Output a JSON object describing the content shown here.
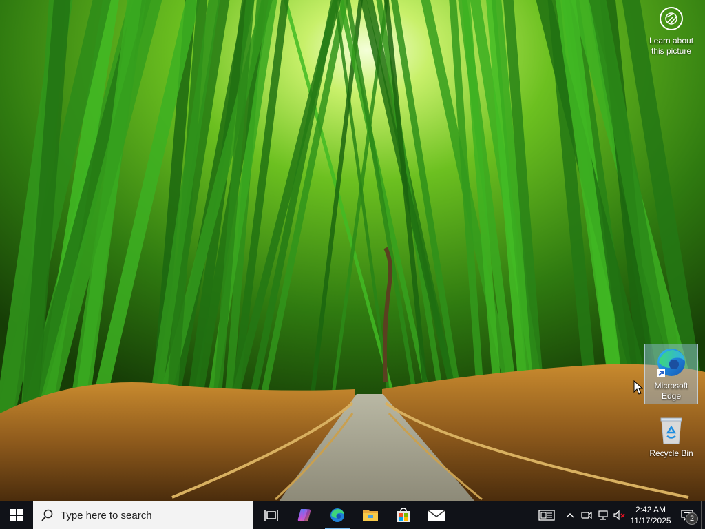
{
  "spotlight": {
    "label": "Learn about this picture",
    "icon": "camera-aperture-icon"
  },
  "desktop_icons": [
    {
      "name": "microsoft-edge",
      "label": "Microsoft Edge",
      "selected": true,
      "icon": "edge-icon"
    },
    {
      "name": "recycle-bin",
      "label": "Recycle Bin",
      "selected": false,
      "icon": "recycle-bin-icon"
    }
  ],
  "taskbar": {
    "search_placeholder": "Type here to search",
    "apps": [
      {
        "name": "copilot",
        "icon": "copilot-icon"
      },
      {
        "name": "edge",
        "icon": "edge-icon",
        "active": true
      },
      {
        "name": "file-explorer",
        "icon": "folder-icon"
      },
      {
        "name": "microsoft-store",
        "icon": "store-icon"
      },
      {
        "name": "mail",
        "icon": "mail-icon"
      }
    ],
    "tray_icons": [
      "news-icon",
      "chevron-up-icon",
      "meet-now-icon",
      "network-icon",
      "volume-muted-icon"
    ],
    "clock": {
      "time": "2:42 AM",
      "date": "11/17/2025"
    },
    "notification_count": "2"
  },
  "colors": {
    "taskbar_bg": "#101218",
    "accent": "#76b9ed"
  }
}
